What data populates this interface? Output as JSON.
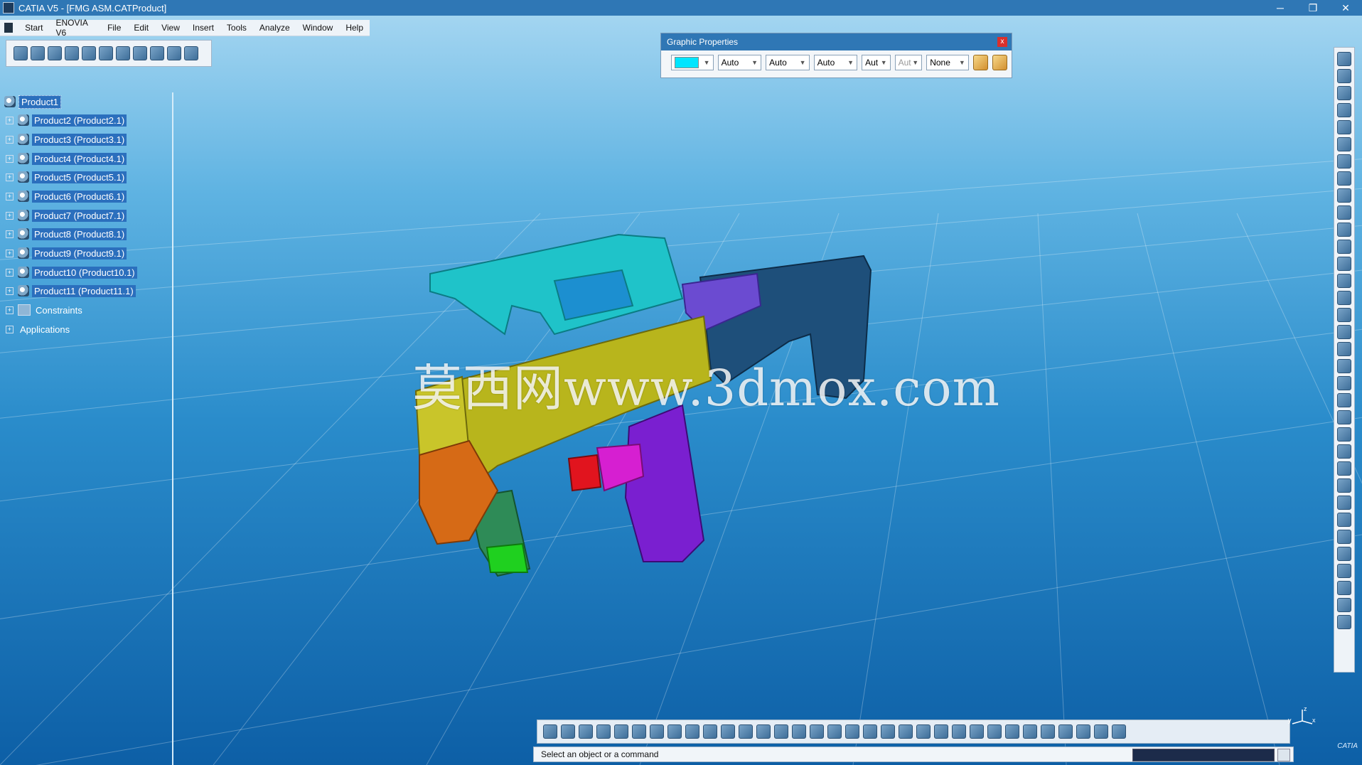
{
  "window": {
    "title": "CATIA V5 - [FMG ASM.CATProduct]",
    "controls": [
      "─",
      "❐",
      "✕"
    ]
  },
  "menubar": {
    "items": [
      "Start",
      "ENOVIA V6",
      "File",
      "Edit",
      "View",
      "Insert",
      "Tools",
      "Analyze",
      "Window",
      "Help"
    ]
  },
  "tree": {
    "root": "Product1",
    "children": [
      "Product2 (Product2.1)",
      "Product3 (Product3.1)",
      "Product4 (Product4.1)",
      "Product5 (Product5.1)",
      "Product6 (Product6.1)",
      "Product7 (Product7.1)",
      "Product8 (Product8.1)",
      "Product9 (Product9.1)",
      "Product10 (Product10.1)",
      "Product11 (Product11.1)"
    ],
    "constraints_label": "Constraints",
    "applications_label": "Applications"
  },
  "graphic_properties": {
    "title": "Graphic Properties",
    "close_label": "x",
    "fill_color": "#00e5ff",
    "transparency": "Auto",
    "line_thickness": "Auto",
    "line_type": "Auto",
    "point_symbol": "Aut",
    "rendering": "Aut",
    "layer": "None"
  },
  "status": {
    "message": "Select an object or a command"
  },
  "watermark": "莫西网www.3dmox.com",
  "compass": {
    "x_label": "x",
    "y_label": "y",
    "z_label": "z"
  },
  "logo_text": "CATIA",
  "colors": {
    "titlebar": "#2f77b5",
    "selection": "#2b6fbd",
    "part_cyan": "#20c7cf",
    "part_olive": "#b9b61e",
    "part_orange": "#d66a16",
    "part_purple": "#7a1fd0",
    "part_navy": "#1e4f7a",
    "part_magenta": "#d61fd1",
    "part_red": "#e1141e",
    "part_green": "#1fd01f"
  }
}
